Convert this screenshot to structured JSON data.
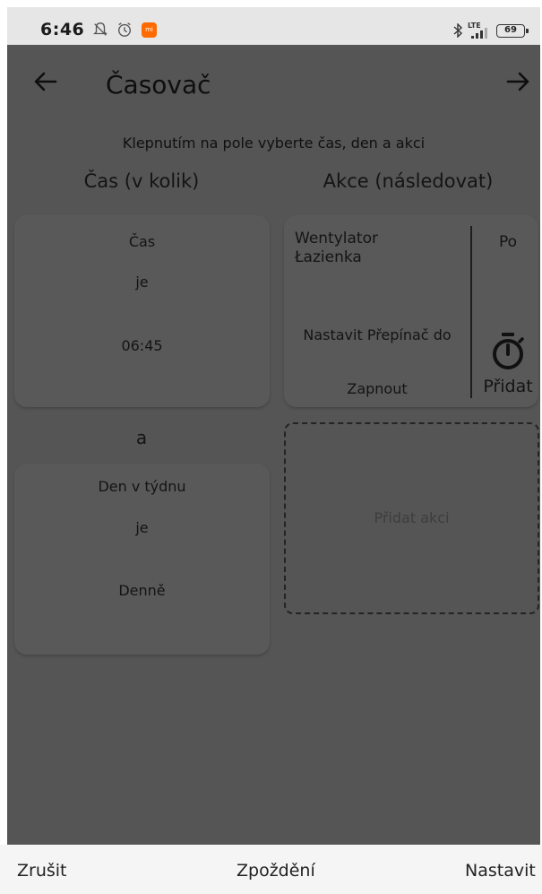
{
  "status": {
    "time": "6:46",
    "battery": "69",
    "network": "LTE",
    "icons": [
      "notifications-off-icon",
      "alarm-icon",
      "mi-app-icon",
      "bluetooth-icon",
      "signal-icon",
      "battery-icon"
    ]
  },
  "appbar": {
    "title": "Časovač",
    "back_icon": "arrow-left-icon",
    "forward_icon": "arrow-right-icon"
  },
  "hint": "Klepnutím na pole vyberte čas, den a akci",
  "columns": {
    "time_header": "Čas (v kolik)",
    "action_header": "Akce (následovat)"
  },
  "time_card": {
    "label": "Čas",
    "operator": "je",
    "value": "06:45"
  },
  "conjunction": "a",
  "day_card": {
    "label": "Den v týdnu",
    "operator": "je",
    "value": "Denně"
  },
  "action_card": {
    "device_line1": "Wentylator",
    "device_line2": "Łazienka",
    "day": "Po",
    "description": "Nastavit Přepínač do",
    "value": "Zapnout",
    "add_label": "Přidat",
    "add_icon": "timer-icon"
  },
  "add_action": {
    "label": "Přidat akci"
  },
  "footer": {
    "cancel": "Zrušit",
    "delay": "Zpoždění",
    "set": "Nastavit"
  },
  "colors": {
    "overlay": "#555555",
    "card": "#595959",
    "footer": "#f5f5f5",
    "text": "#141414"
  }
}
